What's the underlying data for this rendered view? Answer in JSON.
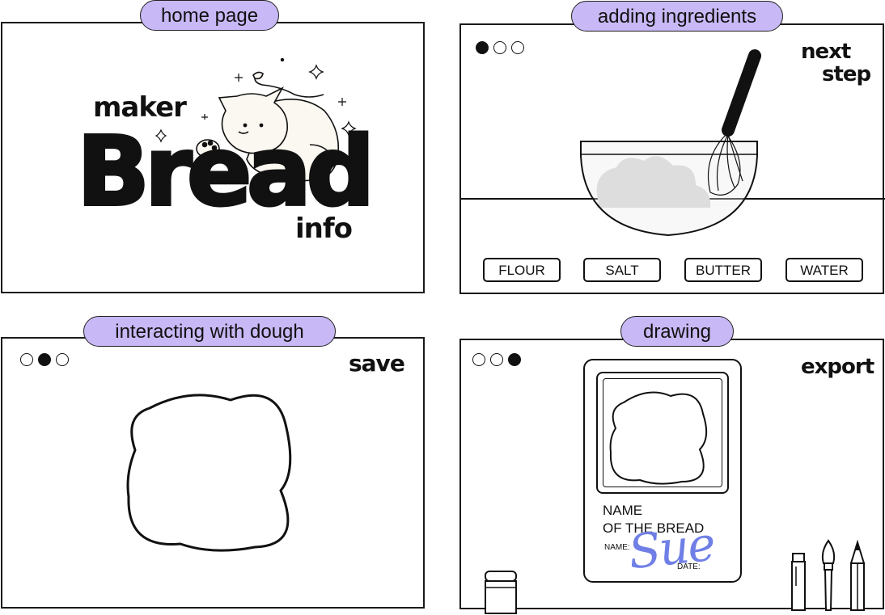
{
  "panels": {
    "home": {
      "title": "home page",
      "logo_top": "maker",
      "logo_main": "Bread",
      "logo_bottom": "info"
    },
    "ingredients": {
      "title": "adding ingredients",
      "steps": [
        true,
        false,
        false
      ],
      "next_label_1": "next",
      "next_label_2": "step",
      "buttons": [
        "FLOUR",
        "SALT",
        "BUTTER",
        "WATER"
      ]
    },
    "dough": {
      "title": "interacting with dough",
      "steps": [
        false,
        true,
        false
      ],
      "save_label": "save"
    },
    "drawing": {
      "title": "drawing",
      "steps": [
        false,
        false,
        true
      ],
      "export_label": "export",
      "card_name_1": "NAME",
      "card_name_2": "OF THE BREAD",
      "card_name_field": "NAME:",
      "card_date_field": "DATE:",
      "signature": "Sue",
      "signature_color": "#6f7fe6"
    }
  },
  "colors": {
    "pill": "#c8b8f5",
    "stroke": "#111111",
    "dough_gray": "#d6d6d6"
  }
}
